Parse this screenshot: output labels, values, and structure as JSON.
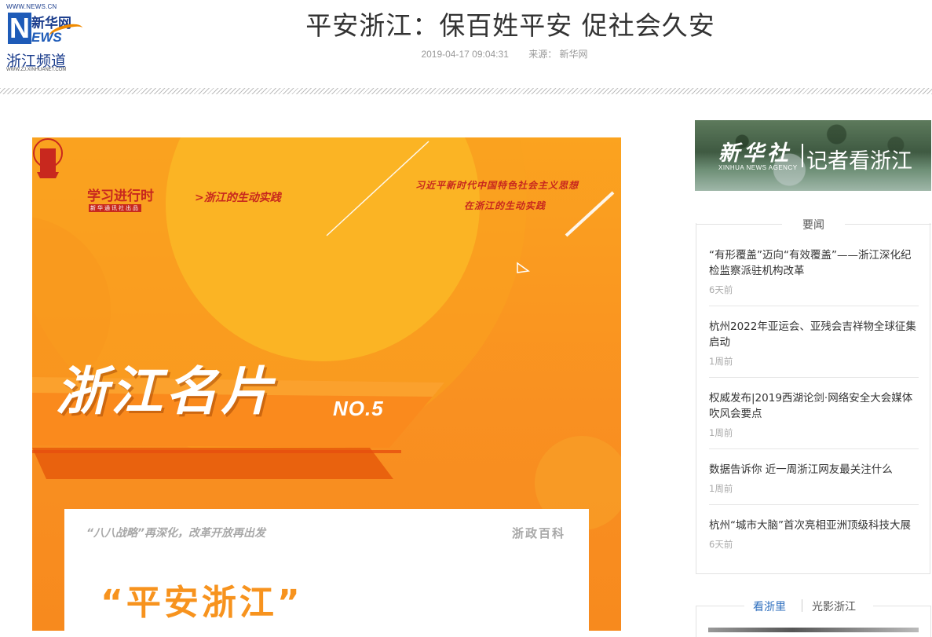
{
  "logo": {
    "url": "WWW.NEWS.CN",
    "letter": "N",
    "ews": "EWS",
    "xinhua": "新华网",
    "channel": "浙江频道",
    "channel_url": "WWW.ZJ.XINHUANET.COM"
  },
  "article": {
    "title": "平安浙江：保百姓平安 促社会久安",
    "datetime": "2019-04-17 09:04:31",
    "source": "来源： 新华网"
  },
  "poster": {
    "brand_main": "学习进行时",
    "brand_press": "新华通讯社出品",
    "subtitle": ">浙江的生动实践",
    "slogan_line1": "习近平新时代中国特色社会主义思想",
    "slogan_line2": "在浙江的生动实践",
    "card_title": "浙江名片",
    "card_no": "NO.5",
    "panel_left": "“八八战略”再深化，改革开放再出发",
    "panel_right": "浙政百科",
    "panel_big": "“平安浙江”",
    "colors": {
      "orange": "#f7931e",
      "red": "#c8281e"
    }
  },
  "sidebar": {
    "banner": {
      "brand": "新华社",
      "agency": "XINHUA NEWS AGENCY",
      "slogan": "记者看浙江"
    },
    "news_section_title": "要闻",
    "news": [
      {
        "title": "“有形覆盖”迈向“有效覆盖”——浙江深化纪检监察派驻机构改革",
        "time": "6天前"
      },
      {
        "title": "杭州2022年亚运会、亚残会吉祥物全球征集启动",
        "time": "1周前"
      },
      {
        "title": "权威发布|2019西湖论剑·网络安全大会媒体吹风会要点",
        "time": "1周前"
      },
      {
        "title": "数据告诉你 近一周浙江网友最关注什么",
        "time": "1周前"
      },
      {
        "title": "杭州“城市大脑”首次亮相亚洲顶级科技大展",
        "time": "6天前"
      }
    ],
    "tabs": [
      {
        "label": "看浙里",
        "active": true
      },
      {
        "label": "光影浙江",
        "active": false
      }
    ],
    "accent": "#2f6fbe"
  }
}
